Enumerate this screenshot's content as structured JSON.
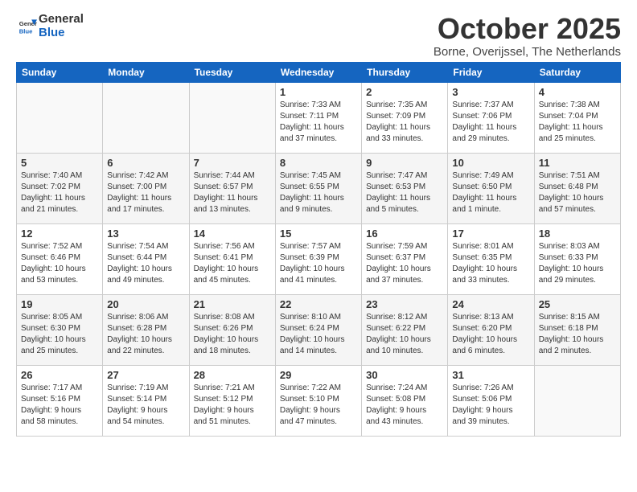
{
  "logo": {
    "line1": "General",
    "line2": "Blue"
  },
  "title": "October 2025",
  "subtitle": "Borne, Overijssel, The Netherlands",
  "days_of_week": [
    "Sunday",
    "Monday",
    "Tuesday",
    "Wednesday",
    "Thursday",
    "Friday",
    "Saturday"
  ],
  "rows": [
    [
      {
        "day": "",
        "content": ""
      },
      {
        "day": "",
        "content": ""
      },
      {
        "day": "",
        "content": ""
      },
      {
        "day": "1",
        "content": "Sunrise: 7:33 AM\nSunset: 7:11 PM\nDaylight: 11 hours\nand 37 minutes."
      },
      {
        "day": "2",
        "content": "Sunrise: 7:35 AM\nSunset: 7:09 PM\nDaylight: 11 hours\nand 33 minutes."
      },
      {
        "day": "3",
        "content": "Sunrise: 7:37 AM\nSunset: 7:06 PM\nDaylight: 11 hours\nand 29 minutes."
      },
      {
        "day": "4",
        "content": "Sunrise: 7:38 AM\nSunset: 7:04 PM\nDaylight: 11 hours\nand 25 minutes."
      }
    ],
    [
      {
        "day": "5",
        "content": "Sunrise: 7:40 AM\nSunset: 7:02 PM\nDaylight: 11 hours\nand 21 minutes."
      },
      {
        "day": "6",
        "content": "Sunrise: 7:42 AM\nSunset: 7:00 PM\nDaylight: 11 hours\nand 17 minutes."
      },
      {
        "day": "7",
        "content": "Sunrise: 7:44 AM\nSunset: 6:57 PM\nDaylight: 11 hours\nand 13 minutes."
      },
      {
        "day": "8",
        "content": "Sunrise: 7:45 AM\nSunset: 6:55 PM\nDaylight: 11 hours\nand 9 minutes."
      },
      {
        "day": "9",
        "content": "Sunrise: 7:47 AM\nSunset: 6:53 PM\nDaylight: 11 hours\nand 5 minutes."
      },
      {
        "day": "10",
        "content": "Sunrise: 7:49 AM\nSunset: 6:50 PM\nDaylight: 11 hours\nand 1 minute."
      },
      {
        "day": "11",
        "content": "Sunrise: 7:51 AM\nSunset: 6:48 PM\nDaylight: 10 hours\nand 57 minutes."
      }
    ],
    [
      {
        "day": "12",
        "content": "Sunrise: 7:52 AM\nSunset: 6:46 PM\nDaylight: 10 hours\nand 53 minutes."
      },
      {
        "day": "13",
        "content": "Sunrise: 7:54 AM\nSunset: 6:44 PM\nDaylight: 10 hours\nand 49 minutes."
      },
      {
        "day": "14",
        "content": "Sunrise: 7:56 AM\nSunset: 6:41 PM\nDaylight: 10 hours\nand 45 minutes."
      },
      {
        "day": "15",
        "content": "Sunrise: 7:57 AM\nSunset: 6:39 PM\nDaylight: 10 hours\nand 41 minutes."
      },
      {
        "day": "16",
        "content": "Sunrise: 7:59 AM\nSunset: 6:37 PM\nDaylight: 10 hours\nand 37 minutes."
      },
      {
        "day": "17",
        "content": "Sunrise: 8:01 AM\nSunset: 6:35 PM\nDaylight: 10 hours\nand 33 minutes."
      },
      {
        "day": "18",
        "content": "Sunrise: 8:03 AM\nSunset: 6:33 PM\nDaylight: 10 hours\nand 29 minutes."
      }
    ],
    [
      {
        "day": "19",
        "content": "Sunrise: 8:05 AM\nSunset: 6:30 PM\nDaylight: 10 hours\nand 25 minutes."
      },
      {
        "day": "20",
        "content": "Sunrise: 8:06 AM\nSunset: 6:28 PM\nDaylight: 10 hours\nand 22 minutes."
      },
      {
        "day": "21",
        "content": "Sunrise: 8:08 AM\nSunset: 6:26 PM\nDaylight: 10 hours\nand 18 minutes."
      },
      {
        "day": "22",
        "content": "Sunrise: 8:10 AM\nSunset: 6:24 PM\nDaylight: 10 hours\nand 14 minutes."
      },
      {
        "day": "23",
        "content": "Sunrise: 8:12 AM\nSunset: 6:22 PM\nDaylight: 10 hours\nand 10 minutes."
      },
      {
        "day": "24",
        "content": "Sunrise: 8:13 AM\nSunset: 6:20 PM\nDaylight: 10 hours\nand 6 minutes."
      },
      {
        "day": "25",
        "content": "Sunrise: 8:15 AM\nSunset: 6:18 PM\nDaylight: 10 hours\nand 2 minutes."
      }
    ],
    [
      {
        "day": "26",
        "content": "Sunrise: 7:17 AM\nSunset: 5:16 PM\nDaylight: 9 hours\nand 58 minutes."
      },
      {
        "day": "27",
        "content": "Sunrise: 7:19 AM\nSunset: 5:14 PM\nDaylight: 9 hours\nand 54 minutes."
      },
      {
        "day": "28",
        "content": "Sunrise: 7:21 AM\nSunset: 5:12 PM\nDaylight: 9 hours\nand 51 minutes."
      },
      {
        "day": "29",
        "content": "Sunrise: 7:22 AM\nSunset: 5:10 PM\nDaylight: 9 hours\nand 47 minutes."
      },
      {
        "day": "30",
        "content": "Sunrise: 7:24 AM\nSunset: 5:08 PM\nDaylight: 9 hours\nand 43 minutes."
      },
      {
        "day": "31",
        "content": "Sunrise: 7:26 AM\nSunset: 5:06 PM\nDaylight: 9 hours\nand 39 minutes."
      },
      {
        "day": "",
        "content": ""
      }
    ]
  ]
}
